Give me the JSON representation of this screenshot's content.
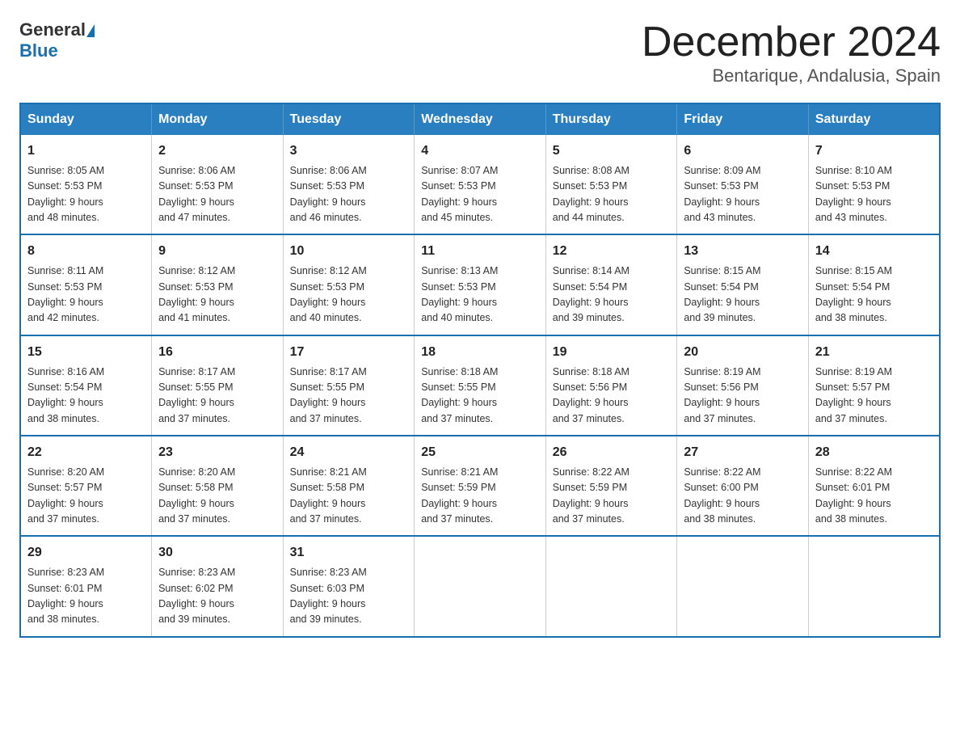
{
  "header": {
    "logo_general": "General",
    "logo_blue": "Blue",
    "month_year": "December 2024",
    "location": "Bentarique, Andalusia, Spain"
  },
  "weekdays": [
    "Sunday",
    "Monday",
    "Tuesday",
    "Wednesday",
    "Thursday",
    "Friday",
    "Saturday"
  ],
  "weeks": [
    [
      {
        "day": "1",
        "sunrise": "8:05 AM",
        "sunset": "5:53 PM",
        "daylight": "9 hours and 48 minutes."
      },
      {
        "day": "2",
        "sunrise": "8:06 AM",
        "sunset": "5:53 PM",
        "daylight": "9 hours and 47 minutes."
      },
      {
        "day": "3",
        "sunrise": "8:06 AM",
        "sunset": "5:53 PM",
        "daylight": "9 hours and 46 minutes."
      },
      {
        "day": "4",
        "sunrise": "8:07 AM",
        "sunset": "5:53 PM",
        "daylight": "9 hours and 45 minutes."
      },
      {
        "day": "5",
        "sunrise": "8:08 AM",
        "sunset": "5:53 PM",
        "daylight": "9 hours and 44 minutes."
      },
      {
        "day": "6",
        "sunrise": "8:09 AM",
        "sunset": "5:53 PM",
        "daylight": "9 hours and 43 minutes."
      },
      {
        "day": "7",
        "sunrise": "8:10 AM",
        "sunset": "5:53 PM",
        "daylight": "9 hours and 43 minutes."
      }
    ],
    [
      {
        "day": "8",
        "sunrise": "8:11 AM",
        "sunset": "5:53 PM",
        "daylight": "9 hours and 42 minutes."
      },
      {
        "day": "9",
        "sunrise": "8:12 AM",
        "sunset": "5:53 PM",
        "daylight": "9 hours and 41 minutes."
      },
      {
        "day": "10",
        "sunrise": "8:12 AM",
        "sunset": "5:53 PM",
        "daylight": "9 hours and 40 minutes."
      },
      {
        "day": "11",
        "sunrise": "8:13 AM",
        "sunset": "5:53 PM",
        "daylight": "9 hours and 40 minutes."
      },
      {
        "day": "12",
        "sunrise": "8:14 AM",
        "sunset": "5:54 PM",
        "daylight": "9 hours and 39 minutes."
      },
      {
        "day": "13",
        "sunrise": "8:15 AM",
        "sunset": "5:54 PM",
        "daylight": "9 hours and 39 minutes."
      },
      {
        "day": "14",
        "sunrise": "8:15 AM",
        "sunset": "5:54 PM",
        "daylight": "9 hours and 38 minutes."
      }
    ],
    [
      {
        "day": "15",
        "sunrise": "8:16 AM",
        "sunset": "5:54 PM",
        "daylight": "9 hours and 38 minutes."
      },
      {
        "day": "16",
        "sunrise": "8:17 AM",
        "sunset": "5:55 PM",
        "daylight": "9 hours and 37 minutes."
      },
      {
        "day": "17",
        "sunrise": "8:17 AM",
        "sunset": "5:55 PM",
        "daylight": "9 hours and 37 minutes."
      },
      {
        "day": "18",
        "sunrise": "8:18 AM",
        "sunset": "5:55 PM",
        "daylight": "9 hours and 37 minutes."
      },
      {
        "day": "19",
        "sunrise": "8:18 AM",
        "sunset": "5:56 PM",
        "daylight": "9 hours and 37 minutes."
      },
      {
        "day": "20",
        "sunrise": "8:19 AM",
        "sunset": "5:56 PM",
        "daylight": "9 hours and 37 minutes."
      },
      {
        "day": "21",
        "sunrise": "8:19 AM",
        "sunset": "5:57 PM",
        "daylight": "9 hours and 37 minutes."
      }
    ],
    [
      {
        "day": "22",
        "sunrise": "8:20 AM",
        "sunset": "5:57 PM",
        "daylight": "9 hours and 37 minutes."
      },
      {
        "day": "23",
        "sunrise": "8:20 AM",
        "sunset": "5:58 PM",
        "daylight": "9 hours and 37 minutes."
      },
      {
        "day": "24",
        "sunrise": "8:21 AM",
        "sunset": "5:58 PM",
        "daylight": "9 hours and 37 minutes."
      },
      {
        "day": "25",
        "sunrise": "8:21 AM",
        "sunset": "5:59 PM",
        "daylight": "9 hours and 37 minutes."
      },
      {
        "day": "26",
        "sunrise": "8:22 AM",
        "sunset": "5:59 PM",
        "daylight": "9 hours and 37 minutes."
      },
      {
        "day": "27",
        "sunrise": "8:22 AM",
        "sunset": "6:00 PM",
        "daylight": "9 hours and 38 minutes."
      },
      {
        "day": "28",
        "sunrise": "8:22 AM",
        "sunset": "6:01 PM",
        "daylight": "9 hours and 38 minutes."
      }
    ],
    [
      {
        "day": "29",
        "sunrise": "8:23 AM",
        "sunset": "6:01 PM",
        "daylight": "9 hours and 38 minutes."
      },
      {
        "day": "30",
        "sunrise": "8:23 AM",
        "sunset": "6:02 PM",
        "daylight": "9 hours and 39 minutes."
      },
      {
        "day": "31",
        "sunrise": "8:23 AM",
        "sunset": "6:03 PM",
        "daylight": "9 hours and 39 minutes."
      },
      null,
      null,
      null,
      null
    ]
  ],
  "labels": {
    "sunrise": "Sunrise:",
    "sunset": "Sunset:",
    "daylight": "Daylight:"
  }
}
